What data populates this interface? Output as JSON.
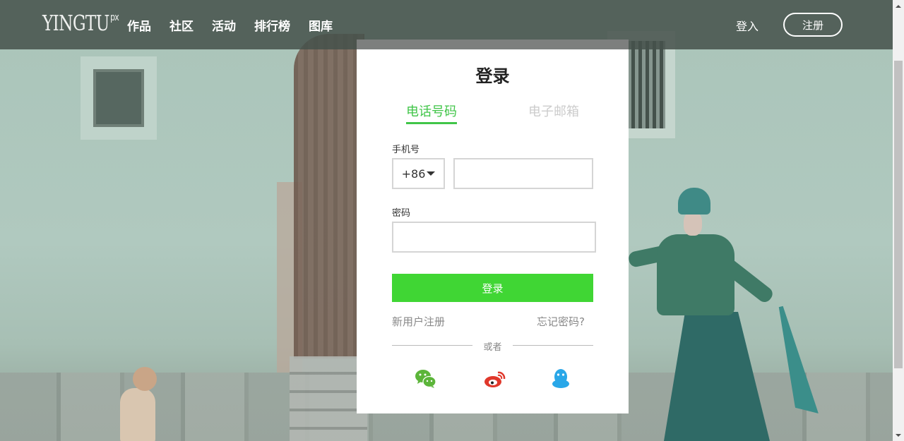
{
  "header": {
    "logo_text": "YINGTU",
    "logo_sup": "px",
    "nav": [
      "作品",
      "社区",
      "活动",
      "排行榜",
      "图库"
    ],
    "login_label": "登入",
    "register_label": "注册"
  },
  "login": {
    "title": "登录",
    "tabs": [
      {
        "label": "电话号码",
        "active": true
      },
      {
        "label": "电子邮箱",
        "active": false
      }
    ],
    "phone_label": "手机号",
    "country_code": "+86",
    "phone_value": "",
    "password_label": "密码",
    "password_value": "",
    "submit_label": "登录",
    "new_user_label": "新用户注册",
    "forgot_label": "忘记密码?",
    "or_label": "或者",
    "social": [
      {
        "name": "wechat-icon",
        "color": "#5cb53a"
      },
      {
        "name": "weibo-icon",
        "color": "#e0382b"
      },
      {
        "name": "qq-icon",
        "color": "#29a7e8"
      }
    ]
  },
  "colors": {
    "accent": "#40c548",
    "button": "#40d634",
    "header_bg": "#46524c"
  }
}
